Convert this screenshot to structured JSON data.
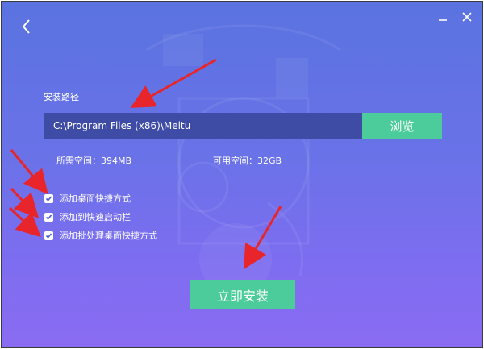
{
  "header": {
    "back_icon": "chevron-left-icon",
    "minimize_icon": "minimize-icon",
    "close_icon": "close-icon"
  },
  "install": {
    "path_label": "安装路径",
    "path_value": "C:\\Program Files (x86)\\Meitu",
    "browse_label": "浏览",
    "required_space": "所需空间：394MB",
    "available_space": "可用空间：32GB",
    "options": [
      {
        "label": "添加桌面快捷方式",
        "checked": true
      },
      {
        "label": "添加到快速启动栏",
        "checked": true
      },
      {
        "label": "添加批处理桌面快捷方式",
        "checked": true
      }
    ],
    "install_label": "立即安装"
  },
  "colors": {
    "accent_green": "#4ccc9a",
    "input_bg": "#3e4ca6",
    "annotation_red": "#e8252a"
  }
}
